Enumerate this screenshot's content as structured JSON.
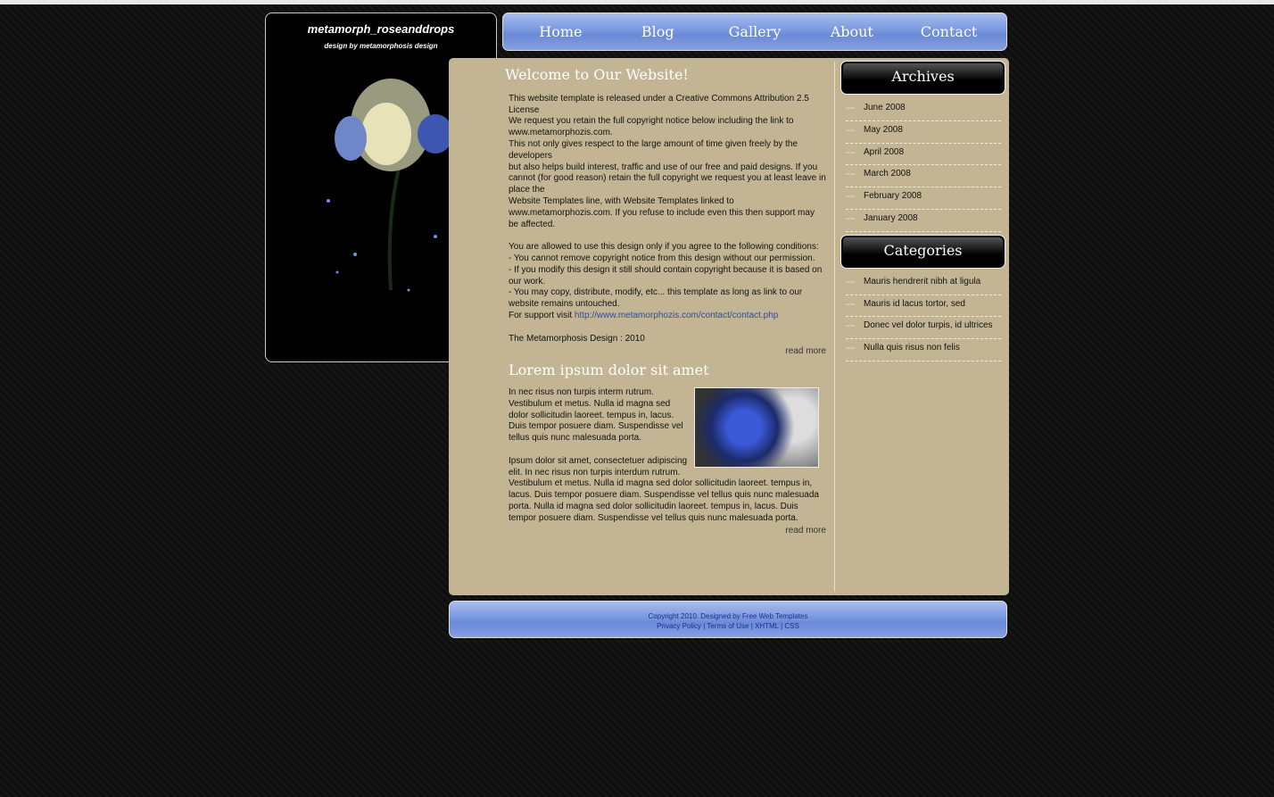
{
  "site": {
    "title": "metamorph_roseanddrops",
    "subtitle": "design by metamorphosis design"
  },
  "nav": [
    "Home",
    "Blog",
    "Gallery",
    "About",
    "Contact"
  ],
  "post1": {
    "title": "Welcome to Our Website!",
    "lines": [
      "This website template is released under a Creative Commons Attribution 2.5 License",
      "We request you retain the full copyright notice below including the link to www.metamorphozis.com.",
      "This not only gives respect to the large amount of time given freely by the developers",
      "but also helps build interest, traffic and use of our free and paid designs. If you cannot (for good reason) retain the full copyright we request you at least leave in place the",
      "Website Templates line, with Website Templates linked to www.metamorphozis.com. If you refuse to include even this then support may be affected."
    ],
    "lines2": [
      "You are allowed to use this design only if you agree to the following conditions:",
      "- You cannot remove copyright notice from this design without our permission.",
      "- If you modify this design it still should contain copyright because it is based on our work.",
      "- You may copy, distribute, modify, etc... this template as long as link to our website remains untouched."
    ],
    "support": "For support visit ",
    "support_link": "http://www.metamorphozis.com/contact/contact.php",
    "sign": "The Metamorphosis Design : 2010",
    "read_more": "read more"
  },
  "post2": {
    "title": "Lorem ipsum dolor sit amet",
    "p1": "In nec risus non turpis interm rutrum. Vestibulum et metus. Nulla id magna sed dolor sollicitudin laoreet. tempus in, lacus. Duis tempor posuere diam. Suspendisse vel tellus quis nunc malesuada porta.",
    "p2": "Ipsum dolor sit amet, consectetuer adipiscing elit. In nec risus non turpis interdum rutrum. Vestibulum et metus. Nulla id magna sed dolor sollicitudin laoreet. tempus in, lacus. Duis tempor posuere diam. Suspendisse vel tellus quis nunc malesuada porta. Nulla id magna sed dolor sollicitudin laoreet. tempus in, lacus. Duis tempor posuere diam. Suspendisse vel tellus quis nunc malesuada porta.",
    "read_more": "read more"
  },
  "archives": {
    "title": "Archives",
    "items": [
      "June 2008",
      "May 2008",
      "April 2008",
      "March 2008",
      "February 2008",
      "January 2008"
    ]
  },
  "categories": {
    "title": "Categories",
    "items": [
      "Mauris hendrerit nibh at ligula",
      "Mauris id lacus tortor, sed",
      "Donec vel dolor turpis, id ultrices",
      "Nulla quis risus non felis"
    ]
  },
  "footer": {
    "copyright": "Copyright 2010. Designed by Free Web Templates",
    "links": [
      "Privacy Policy",
      "Terms of Use",
      "XHTML",
      "CSS"
    ]
  }
}
